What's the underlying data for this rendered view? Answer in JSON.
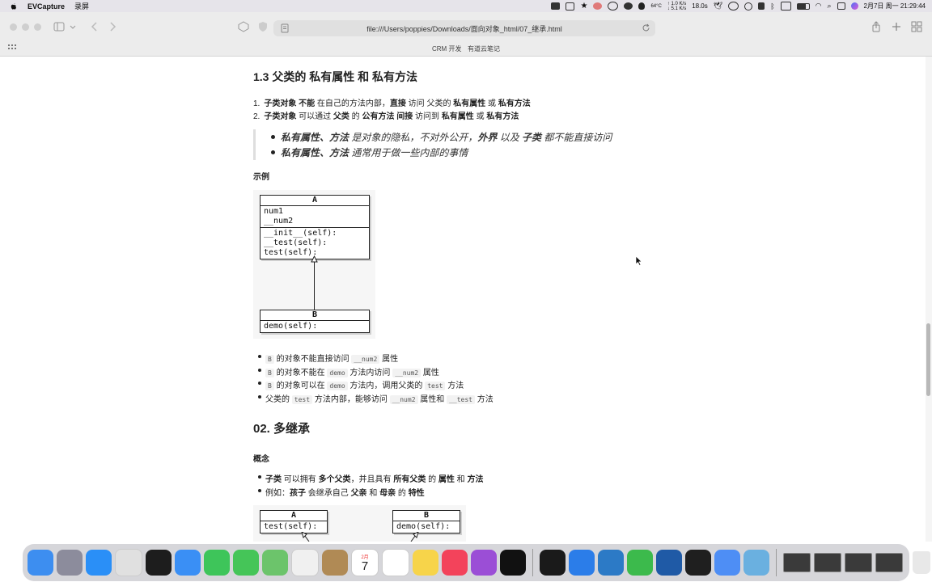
{
  "menubar": {
    "app_name": "EVCapture",
    "menu_record": "录屏",
    "temperature": "64°C",
    "net_up": "↑ 1.0 K/s",
    "net_down": "↓ 5.1 K/s",
    "cpu": "18.0s",
    "datetime": "2月7日 周一 21:29:44"
  },
  "browser": {
    "url": "file:///Users/poppies/Downloads/面向对象_html/07_继承.html",
    "bookmarks": [
      "CRM 开发",
      "有道云笔记"
    ]
  },
  "section_1_3": {
    "heading": "1.3 父类的 私有属性 和 私有方法",
    "ordered": [
      {
        "num": "1.",
        "segments": [
          [
            "子类对象 不能",
            true
          ],
          [
            " 在自己的方法内部，",
            false
          ],
          [
            "直接",
            true
          ],
          [
            " 访问 父类的 ",
            false
          ],
          [
            "私有属性",
            true
          ],
          [
            " 或 ",
            false
          ],
          [
            "私有方法",
            true
          ]
        ]
      },
      {
        "num": "2.",
        "segments": [
          [
            "子类对象",
            true
          ],
          [
            " 可以通过 ",
            false
          ],
          [
            "父类",
            true
          ],
          [
            " 的 ",
            false
          ],
          [
            "公有方法 间接",
            true
          ],
          [
            " 访问到 ",
            false
          ],
          [
            "私有属性",
            true
          ],
          [
            " 或 ",
            false
          ],
          [
            "私有方法",
            true
          ]
        ]
      }
    ],
    "quote": [
      {
        "segments": [
          [
            "私有属性、方法",
            true
          ],
          [
            " 是对象的隐私，不对外公开，",
            false
          ],
          [
            "外界",
            true
          ],
          [
            " 以及 ",
            false
          ],
          [
            "子类",
            true
          ],
          [
            " 都不能直接访问",
            false
          ]
        ]
      },
      {
        "segments": [
          [
            "私有属性、方法",
            true
          ],
          [
            " 通常用于做一些内部的事情",
            false
          ]
        ]
      }
    ],
    "example_label": "示例",
    "uml": {
      "class_a": {
        "name": "A",
        "attrs": [
          "num1",
          "__num2"
        ],
        "methods": [
          "__init__(self):",
          "__test(self):",
          "test(self):"
        ]
      },
      "class_b": {
        "name": "B",
        "methods": [
          "demo(self):"
        ]
      }
    },
    "bullets": [
      {
        "segments": [
          [
            "B",
            "code"
          ],
          [
            " 的对象不能直接访问 ",
            "text"
          ],
          [
            "__num2",
            "code"
          ],
          [
            " 属性",
            "text"
          ]
        ]
      },
      {
        "segments": [
          [
            "B",
            "code"
          ],
          [
            " 的对象不能在 ",
            "text"
          ],
          [
            "demo",
            "code"
          ],
          [
            " 方法内访问 ",
            "text"
          ],
          [
            "__num2",
            "code"
          ],
          [
            " 属性",
            "text"
          ]
        ]
      },
      {
        "segments": [
          [
            "B",
            "code"
          ],
          [
            " 的对象可以在 ",
            "text"
          ],
          [
            "demo",
            "code"
          ],
          [
            " 方法内，调用父类的 ",
            "text"
          ],
          [
            "test",
            "code"
          ],
          [
            " 方法",
            "text"
          ]
        ]
      },
      {
        "segments": [
          [
            "父类的 ",
            "text"
          ],
          [
            "test",
            "code"
          ],
          [
            " 方法内部，能够访问 ",
            "text"
          ],
          [
            "__num2",
            "code"
          ],
          [
            " 属性和 ",
            "text"
          ],
          [
            "__test",
            "code"
          ],
          [
            " 方法",
            "text"
          ]
        ]
      }
    ]
  },
  "section_02": {
    "heading": "02. 多继承",
    "concept_label": "概念",
    "bullets": [
      {
        "segments": [
          [
            "子类",
            true
          ],
          [
            " 可以拥有 ",
            false
          ],
          [
            "多个父类",
            true
          ],
          [
            "，并且具有 ",
            false
          ],
          [
            "所有父类",
            true
          ],
          [
            " 的 ",
            false
          ],
          [
            "属性",
            true
          ],
          [
            " 和 ",
            false
          ],
          [
            "方法",
            true
          ]
        ]
      },
      {
        "segments": [
          [
            "例如：",
            false
          ],
          [
            "孩子",
            true
          ],
          [
            " 会继承自己 ",
            false
          ],
          [
            "父亲",
            true
          ],
          [
            " 和 ",
            false
          ],
          [
            "母亲",
            true
          ],
          [
            " 的 ",
            false
          ],
          [
            "特性",
            true
          ]
        ]
      }
    ],
    "uml": {
      "class_a": {
        "name": "A",
        "methods": [
          "test(self):"
        ]
      },
      "class_b": {
        "name": "B",
        "methods": [
          "demo(self):"
        ]
      }
    }
  },
  "dock": {
    "calendar_month": "2月",
    "calendar_day": "7",
    "apps": [
      "finder-icon",
      "launchpad-icon",
      "safari-icon",
      "chrome-icon",
      "terminal-icon",
      "mail-icon",
      "facetime-icon",
      "messages-icon",
      "maps-icon",
      "photos-icon",
      "books-icon",
      "calendar-icon",
      "reminders-icon",
      "notes-icon",
      "music-icon",
      "podcasts-icon",
      "tv-icon",
      "qq-icon",
      "qq-browser-icon",
      "vscode-icon",
      "wechat-icon",
      "screen-record-icon",
      "pycharm-icon",
      "baidu-netdisk-icon",
      "evcapture-icon"
    ],
    "colors": {
      "finder-icon": "#3d8ef0",
      "launchpad-icon": "#8c8c9c",
      "safari-icon": "#2a8ff7",
      "chrome-icon": "#e0e0e0",
      "terminal-icon": "#1d1d1d",
      "mail-icon": "#3a8ff5",
      "facetime-icon": "#3ec55a",
      "messages-icon": "#45c558",
      "maps-icon": "#6cc46b",
      "photos-icon": "#f0f0f0",
      "books-icon": "#b08a55",
      "calendar-icon": "#ffffff",
      "reminders-icon": "#ffffff",
      "notes-icon": "#f7d44a",
      "music-icon": "#f3435b",
      "podcasts-icon": "#9b4ed6",
      "tv-icon": "#111111",
      "qq-icon": "#1a1a1a",
      "qq-browser-icon": "#2b7de9",
      "vscode-icon": "#2c7ac6",
      "wechat-icon": "#3cba4c",
      "screen-record-icon": "#1f5aa6",
      "pycharm-icon": "#1f1f1f",
      "baidu-netdisk-icon": "#4e8ef5",
      "evcapture-icon": "#6ab0e0"
    }
  }
}
